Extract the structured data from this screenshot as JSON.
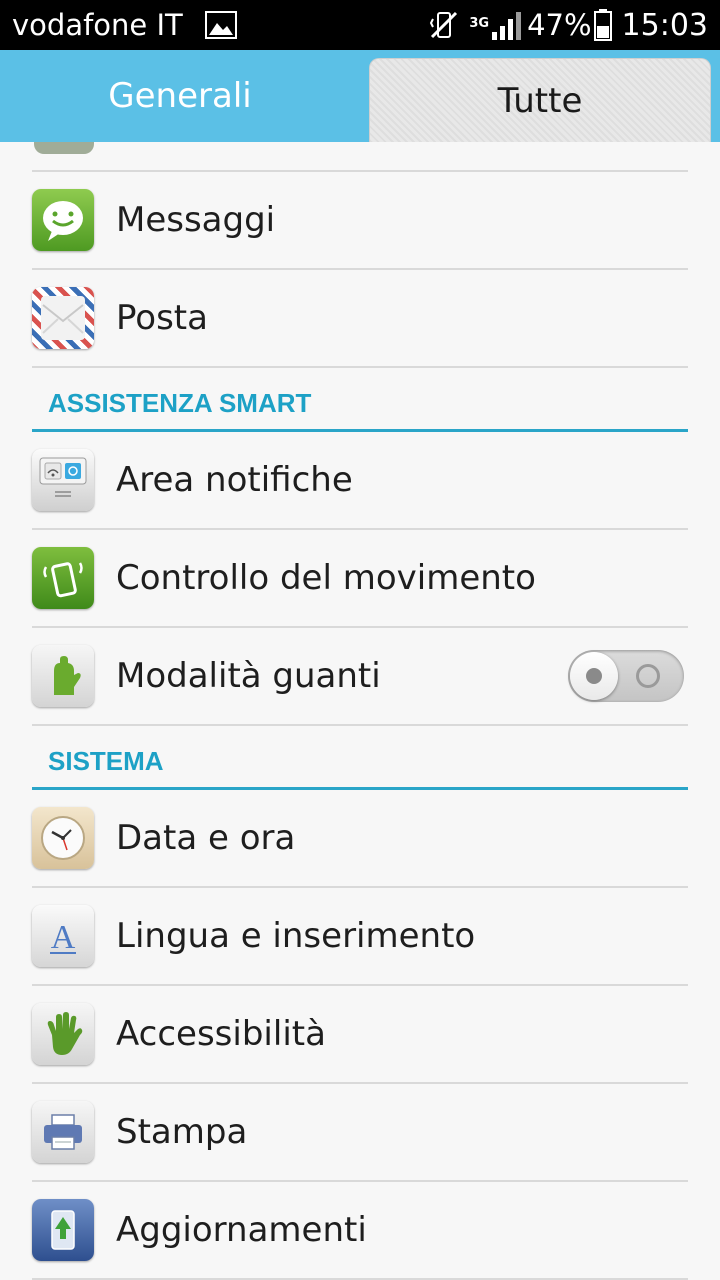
{
  "status_bar": {
    "carrier": "vodafone IT",
    "network": "3G",
    "battery_percent": "47%",
    "time": "15:03"
  },
  "tabs": [
    {
      "label": "Generali",
      "selected": false
    },
    {
      "label": "Tutte",
      "selected": true
    }
  ],
  "sections": {
    "smart": "ASSISTENZA SMART",
    "system": "SISTEMA"
  },
  "items": {
    "messages": "Messaggi",
    "mail": "Posta",
    "notification_area": "Area notifiche",
    "motion_control": "Controllo del movimento",
    "glove_mode": "Modalità guanti",
    "date_time": "Data e ora",
    "language": "Lingua e inserimento",
    "accessibility": "Accessibilità",
    "print": "Stampa",
    "updates": "Aggiornamenti"
  },
  "glove_mode_enabled": false,
  "colors": {
    "tab_bar": "#5bc0e6",
    "section_accent": "#1da1c6",
    "status_bar": "#000000"
  }
}
